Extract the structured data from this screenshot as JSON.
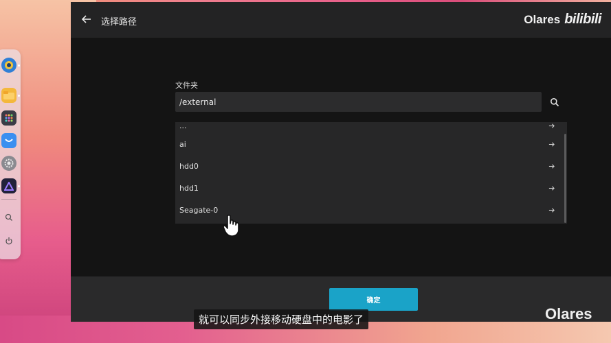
{
  "window": {
    "title": "选择路径",
    "brand": "Olares",
    "brand_logo": "bilibili"
  },
  "form": {
    "folder_label": "文件夹",
    "path_value": "/external"
  },
  "list": {
    "items": [
      {
        "label": "..."
      },
      {
        "label": "ai"
      },
      {
        "label": "hdd0"
      },
      {
        "label": "hdd1"
      },
      {
        "label": "Seagate-0"
      }
    ]
  },
  "footer": {
    "confirm_label": "确定"
  },
  "overlay": {
    "subtitle": "就可以同步外接移动硬盘中的电影了",
    "watermark": "Olares"
  },
  "colors": {
    "accent": "#1aa3c8",
    "window_bg": "#1b1b1c"
  }
}
